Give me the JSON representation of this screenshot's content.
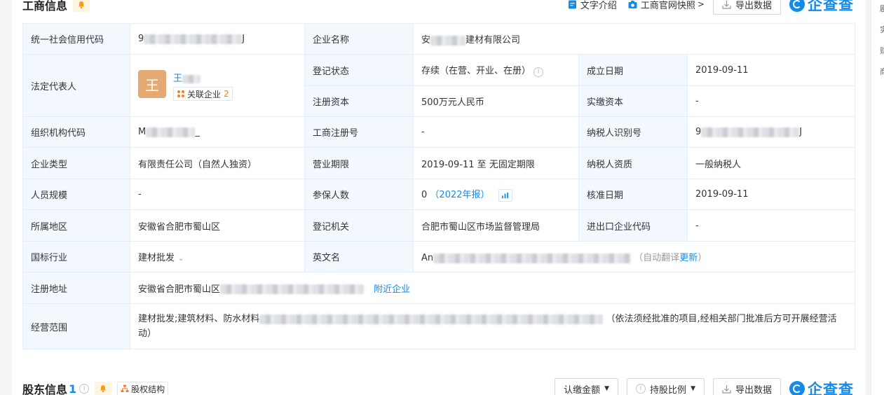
{
  "section1": {
    "title": "工商信息",
    "tools": {
      "intro": "文字介绍",
      "snapshot": "工商官网快照",
      "export": "导出数据"
    },
    "logo": "企查查"
  },
  "fields": {
    "credit_code": {
      "label": "统一社会信用代码",
      "prefix": "9",
      "suffix": "J"
    },
    "company_name": {
      "label": "企业名称",
      "prefix": "安",
      "suffix": "建材有限公司"
    },
    "legal_rep": {
      "label": "法定代表人",
      "avatar": "王",
      "name_prefix": "王",
      "related_label": "关联企业",
      "related_count": "2"
    },
    "reg_status": {
      "label": "登记状态",
      "value": "存续（在营、开业、在册）"
    },
    "found_date": {
      "label": "成立日期",
      "value": "2019-09-11"
    },
    "reg_capital": {
      "label": "注册资本",
      "value": "500万元人民币"
    },
    "paid_capital": {
      "label": "实缴资本",
      "value": "-"
    },
    "org_code": {
      "label": "组织机构代码",
      "prefix": "M",
      "suffix": "_"
    },
    "biz_reg_no": {
      "label": "工商注册号",
      "value": "-"
    },
    "taxpayer_id": {
      "label": "纳税人识别号",
      "prefix": "9",
      "suffix": "J"
    },
    "company_type": {
      "label": "企业类型",
      "value": "有限责任公司（自然人独资）"
    },
    "biz_term": {
      "label": "营业期限",
      "value": "2019-09-11 至 无固定期限"
    },
    "taxpayer_qual": {
      "label": "纳税人资质",
      "value": "一般纳税人"
    },
    "staff_size": {
      "label": "人员规模",
      "value": "-"
    },
    "insured": {
      "label": "参保人数",
      "value": "0",
      "report": "（2022年报）"
    },
    "approve_date": {
      "label": "核准日期",
      "value": "2019-09-11"
    },
    "region": {
      "label": "所属地区",
      "value": "安徽省合肥市蜀山区"
    },
    "reg_authority": {
      "label": "登记机关",
      "value": "合肥市蜀山区市场监督管理局"
    },
    "import_export": {
      "label": "进出口企业代码",
      "value": "-"
    },
    "industry": {
      "label": "国标行业",
      "value": "建材批发"
    },
    "english_name": {
      "label": "英文名",
      "prefix": "An",
      "note": "（自动翻译",
      "update": "更新",
      "close": "）"
    },
    "reg_address": {
      "label": "注册地址",
      "prefix": "安徽省合肥市蜀山区",
      "nearby": "附近企业"
    },
    "biz_scope": {
      "label": "经营范围",
      "prefix": "建材批发;建筑材料、防水材料",
      "suffix": "（依法须经批准的项目,经相关部门批准后方可开展经营活动）"
    }
  },
  "section2": {
    "title": "股东信息",
    "count": "1",
    "equity_tag": "股权结构",
    "tools": {
      "subscribed": "认缴金额",
      "ratio": "持股比例",
      "export": "导出数据"
    },
    "logo": "企查查"
  },
  "right_strip": [
    "剧",
    "实",
    "财",
    "商"
  ],
  "colors": {
    "accent": "#128bed",
    "label_bg": "#f2f8fe",
    "border": "#e4eef6",
    "orange": "#fd7c1e",
    "avatar": "#e5aa73"
  }
}
